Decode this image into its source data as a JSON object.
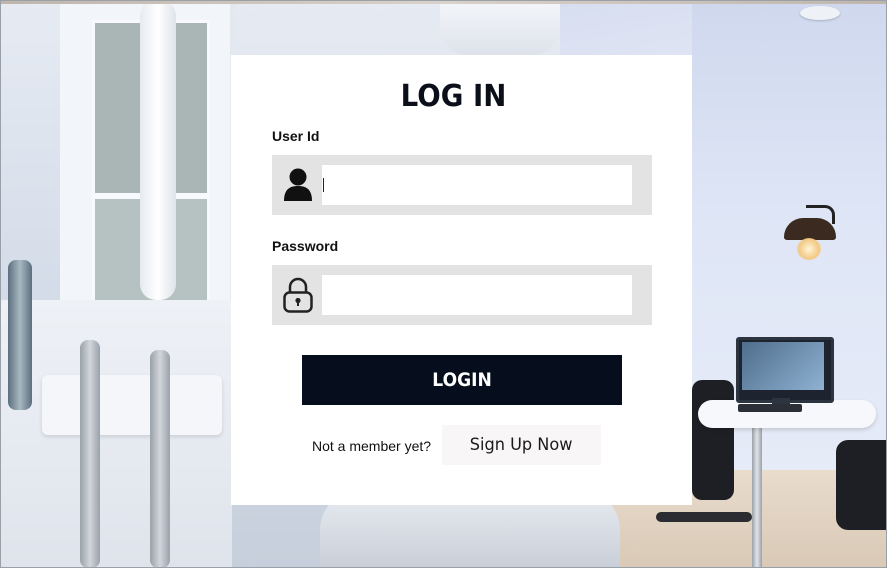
{
  "login": {
    "title": "LOG IN",
    "user_id": {
      "label": "User Id",
      "value": "",
      "icon": "user-icon"
    },
    "password": {
      "label": "Password",
      "value": "",
      "icon": "lock-icon"
    },
    "login_button": "LOGIN",
    "signup_prompt": "Not a member yet?",
    "signup_button": "Sign Up Now"
  },
  "colors": {
    "card_background": "#ffffff",
    "field_background": "#e3e3e3",
    "login_button": "#060d1c",
    "signup_button": "#f8f6f6",
    "title_text": "#0b0f19"
  }
}
